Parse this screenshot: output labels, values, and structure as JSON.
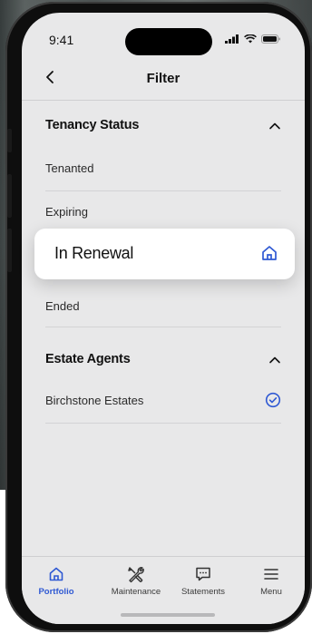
{
  "status_bar": {
    "time": "9:41"
  },
  "header": {
    "back_icon": "chevron-left-icon",
    "title": "Filter"
  },
  "tenancy": {
    "title": "Tenancy Status",
    "items": [
      {
        "label": "Tenanted"
      },
      {
        "label": "Expiring"
      },
      {
        "label": "In Renewal",
        "icon": "home-icon",
        "highlighted": true
      },
      {
        "label": "Ended"
      }
    ]
  },
  "agents": {
    "title": "Estate Agents",
    "items": [
      {
        "label": "Birchstone Estates",
        "checked": true
      }
    ]
  },
  "tabs": [
    {
      "label": "Portfolio",
      "icon": "home-icon",
      "active": true
    },
    {
      "label": "Maintenance",
      "icon": "tools-icon"
    },
    {
      "label": "Statements",
      "icon": "message-icon"
    },
    {
      "label": "Menu",
      "icon": "menu-icon"
    }
  ],
  "colors": {
    "accent": "#2f59d3",
    "screen_bg": "#e8e8e9",
    "card_bg": "#ffffff"
  }
}
